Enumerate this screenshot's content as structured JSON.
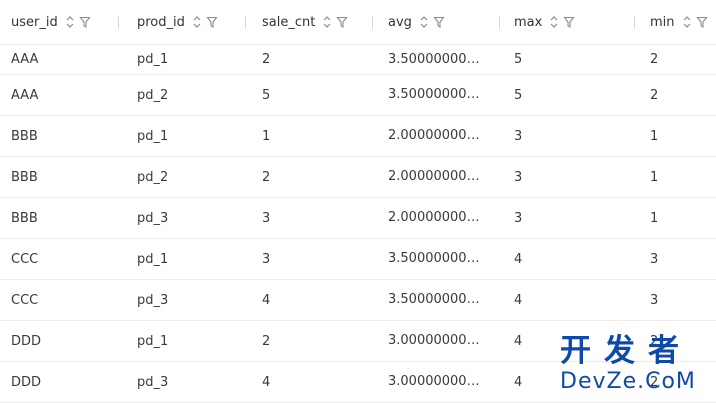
{
  "table": {
    "columns": [
      {
        "label": "user_id"
      },
      {
        "label": "prod_id"
      },
      {
        "label": "sale_cnt"
      },
      {
        "label": "avg"
      },
      {
        "label": "max"
      },
      {
        "label": "min"
      }
    ],
    "rows": [
      [
        "AAA",
        "pd_1",
        "2",
        "3.500000000000",
        "5",
        "2"
      ],
      [
        "AAA",
        "pd_2",
        "5",
        "3.500000000000",
        "5",
        "2"
      ],
      [
        "BBB",
        "pd_1",
        "1",
        "2.000000000000",
        "3",
        "1"
      ],
      [
        "BBB",
        "pd_2",
        "2",
        "2.000000000000",
        "3",
        "1"
      ],
      [
        "BBB",
        "pd_3",
        "3",
        "2.000000000000",
        "3",
        "1"
      ],
      [
        "CCC",
        "pd_1",
        "3",
        "3.500000000000",
        "4",
        "3"
      ],
      [
        "CCC",
        "pd_3",
        "4",
        "3.500000000000",
        "4",
        "3"
      ],
      [
        "DDD",
        "pd_1",
        "2",
        "3.000000000000",
        "4",
        "2"
      ],
      [
        "DDD",
        "pd_3",
        "4",
        "3.000000000000",
        "4",
        "2"
      ]
    ]
  },
  "icons": {
    "sort": "sort-icon",
    "filter": "filter-icon"
  },
  "watermark": {
    "cn": "开发者",
    "en": "DevZe.CoM"
  },
  "colors": {
    "text": "#3a3a3a",
    "border": "#ececec",
    "icon": "#8c8c8c",
    "watermark": "#0f4aa7"
  }
}
